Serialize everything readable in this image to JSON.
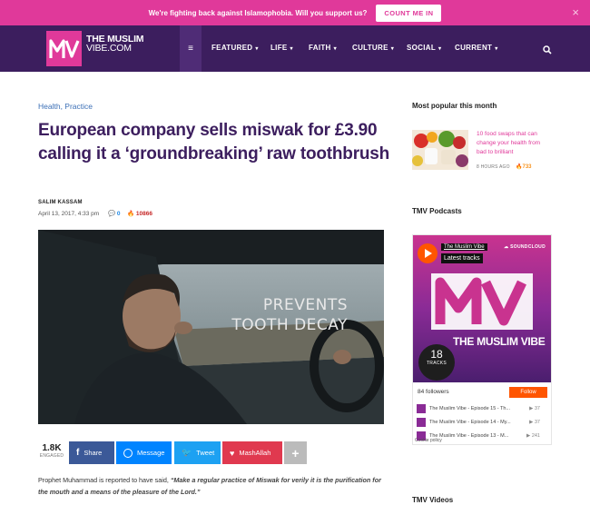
{
  "banner": {
    "text": "We're fighting back against Islamophobia. Will you support us?",
    "button": "COUNT ME IN",
    "close": "×"
  },
  "logo": {
    "line1": "THE MUSLIM",
    "line2": "VIBE.COM"
  },
  "nav": {
    "menu_icon": "≡",
    "items": [
      {
        "label": "FEATURED"
      },
      {
        "label": "LIFE"
      },
      {
        "label": "FAITH"
      },
      {
        "label": "CULTURE"
      },
      {
        "label": "SOCIAL"
      },
      {
        "label": "CURRENT"
      }
    ],
    "caret": "▾"
  },
  "article": {
    "categories": "Health, Practice",
    "title": "European company sells miswak for £3.90 calling it a ‘groundbreaking’ raw toothbrush",
    "author": "SALIM KASSAM",
    "date": "April 13, 2017, 4:33 pm",
    "comments": "0",
    "views": "10866",
    "image_overlay_line1": "PREVENTS",
    "image_overlay_line2": "TOOTH DECAY",
    "share": {
      "count": "1.8K",
      "count_label": "ENGAGED",
      "buttons": [
        {
          "label": "Share",
          "color": "#3b5998"
        },
        {
          "label": "Message",
          "color": "#0084ff"
        },
        {
          "label": "Tweet",
          "color": "#1da1f2"
        },
        {
          "label": "MashAllah",
          "color": "#e0394f"
        }
      ],
      "more": "+"
    },
    "quote_lead": "Prophet Muhammad is reported to have said, ",
    "quote_text": "“Make a regular practice of Miswak for verily it is the purification for the mouth and a means of the pleasure of the Lord.”"
  },
  "sidebar": {
    "popular_heading": "Most popular this month",
    "popular": {
      "title": "10 food swaps that can change your health from bad to brilliant",
      "time": "8 HOURS AGO",
      "views": "733"
    },
    "podcasts_heading": "TMV Podcasts",
    "soundcloud": {
      "user": "The Muslim Vibe",
      "latest": "Latest tracks",
      "brand": "SOUNDCLOUD",
      "name": "THE MUSLIM VIBE",
      "tracks_count": "18",
      "tracks_label": "TRACKS",
      "followers": "84 followers",
      "follow": "Follow",
      "tracks": [
        {
          "title": "The Muslim Vibe - Episode 15 - Th...",
          "plays": "37"
        },
        {
          "title": "The Muslim Vibe - Episode 14 - My...",
          "plays": "37"
        },
        {
          "title": "The Muslim Vibe - Episode 13 - M...",
          "plays": "241"
        }
      ],
      "cookie": "Cookie policy"
    },
    "videos_heading": "TMV Videos"
  },
  "colors": {
    "brand_pink": "#e0399a",
    "nav_purple": "#3c1e5e",
    "title_purple": "#3c1e5e",
    "link_blue": "#3b6fb6"
  }
}
